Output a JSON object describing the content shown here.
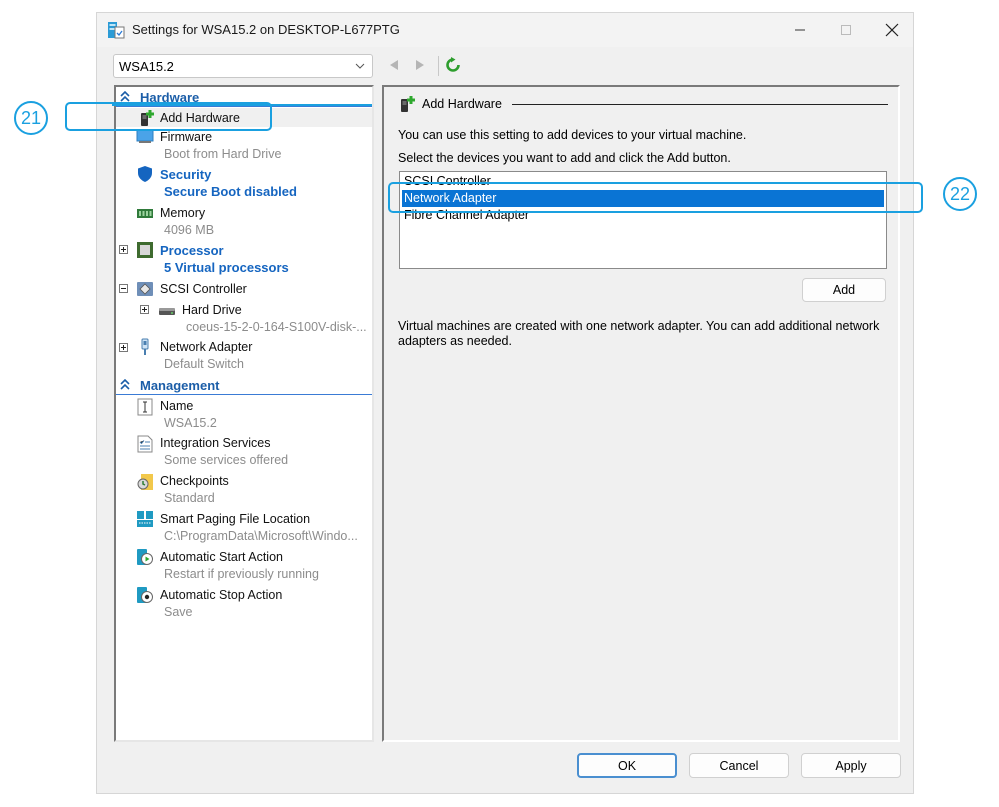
{
  "window": {
    "title": "Settings for WSA15.2 on DESKTOP-L677PTG",
    "controls": {
      "minimize": "minimize",
      "maximize": "maximize",
      "close": "close"
    }
  },
  "toolbar": {
    "vm_selector_value": "WSA15.2"
  },
  "sidebar": {
    "hardware_header": "Hardware",
    "management_header": "Management",
    "hardware_items": [
      {
        "label": "Add Hardware",
        "sub": "",
        "icon": "add-hardware-icon",
        "selected": true
      },
      {
        "label": "Firmware",
        "sub": "Boot from Hard Drive",
        "icon": "firmware-icon"
      },
      {
        "label": "Security",
        "sub": "Secure Boot disabled",
        "icon": "shield-icon",
        "emphasis": true
      },
      {
        "label": "Memory",
        "sub": "4096 MB",
        "icon": "memory-icon"
      },
      {
        "label": "Processor",
        "sub": "5 Virtual processors",
        "icon": "processor-icon",
        "emphasis": true,
        "expander": "plus"
      },
      {
        "label": "SCSI Controller",
        "sub": "",
        "icon": "scsi-controller-icon",
        "expander": "minus"
      },
      {
        "label": "Hard Drive",
        "sub": "coeus-15-2-0-164-S100V-disk-...",
        "icon": "hard-drive-icon",
        "expander": "plus"
      },
      {
        "label": "Network Adapter",
        "sub": "Default Switch",
        "icon": "network-adapter-icon",
        "expander": "plus"
      }
    ],
    "management_items": [
      {
        "label": "Name",
        "sub": "WSA15.2",
        "icon": "name-icon"
      },
      {
        "label": "Integration Services",
        "sub": "Some services offered",
        "icon": "integration-services-icon"
      },
      {
        "label": "Checkpoints",
        "sub": "Standard",
        "icon": "checkpoints-icon"
      },
      {
        "label": "Smart Paging File Location",
        "sub": "C:\\ProgramData\\Microsoft\\Windo...",
        "icon": "smart-paging-icon"
      },
      {
        "label": "Automatic Start Action",
        "sub": "Restart if previously running",
        "icon": "auto-start-icon"
      },
      {
        "label": "Automatic Stop Action",
        "sub": "Save",
        "icon": "auto-stop-icon"
      }
    ]
  },
  "main": {
    "group_title": "Add Hardware",
    "description_1": "You can use this setting to add devices to your virtual machine.",
    "description_2": "Select the devices you want to add and click the Add button.",
    "devices": [
      {
        "label": "SCSI Controller",
        "selected": false
      },
      {
        "label": "Network Adapter",
        "selected": true
      },
      {
        "label": "Fibre Channel Adapter",
        "selected": false
      }
    ],
    "add_button": "Add",
    "note": "Virtual machines are created with one network adapter. You can add additional network adapters as needed."
  },
  "footer": {
    "ok": "OK",
    "cancel": "Cancel",
    "apply": "Apply"
  },
  "callouts": [
    {
      "number": "21",
      "target": "Add Hardware"
    },
    {
      "number": "22",
      "target": "Network Adapter"
    }
  ],
  "colors": {
    "accent": "#1565c0",
    "selection": "#0a74d4",
    "callout": "#1aa0e0",
    "refresh": "#2e9e2e"
  }
}
